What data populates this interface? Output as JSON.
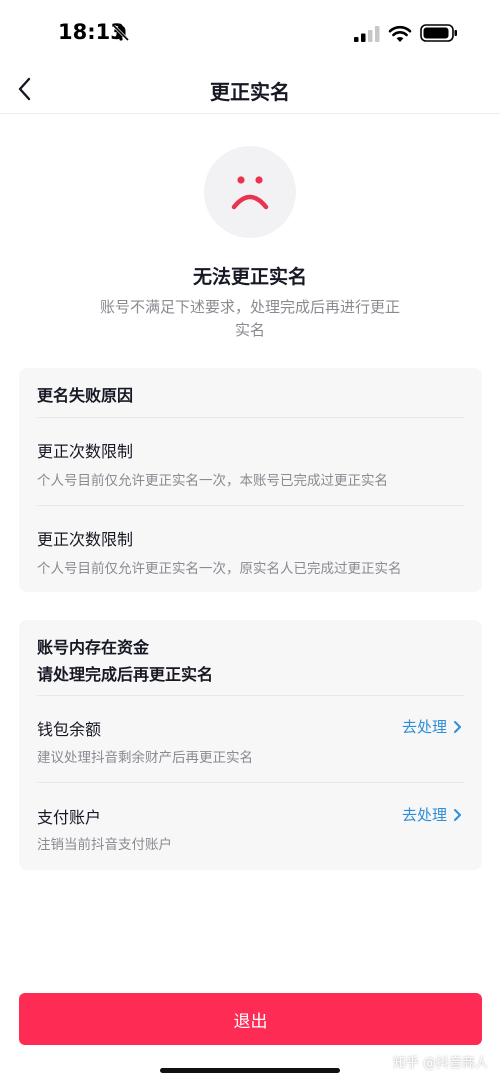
{
  "status_bar": {
    "time": "18:13",
    "icons": [
      "bell-off-icon",
      "signal-icon",
      "wifi-icon",
      "battery-icon"
    ]
  },
  "nav": {
    "back_icon": "chevron-left-icon",
    "title": "更正实名"
  },
  "result": {
    "icon": "sad-face-icon",
    "title": "无法更正实名",
    "description": "账号不满足下述要求，处理完成后再进行更正实名"
  },
  "failure_card": {
    "heading": "更名失败原因",
    "reasons": [
      {
        "title": "更正次数限制",
        "desc": "个人号目前仅允许更正实名一次，本账号已完成过更正实名"
      },
      {
        "title": "更正次数限制",
        "desc": "个人号目前仅允许更正实名一次，原实名人已完成过更正实名"
      }
    ]
  },
  "funds_card": {
    "heading_line1": "账号内存在资金",
    "heading_line2": "请处理完成后再更正实名",
    "items": [
      {
        "title": "钱包余额",
        "desc": "建议处理抖音剩余财产后再更正实名",
        "action": "去处理"
      },
      {
        "title": "支付账户",
        "desc": "注销当前抖音支付账户",
        "action": "去处理"
      }
    ]
  },
  "exit_button": "退出",
  "watermark": "知乎 @抖音商人",
  "colors": {
    "accent": "#fe2c55",
    "link": "#2d8ed9",
    "sad_face": "#e8344f",
    "card_bg": "#f7f7f8",
    "muted_text": "#8a8b91"
  }
}
